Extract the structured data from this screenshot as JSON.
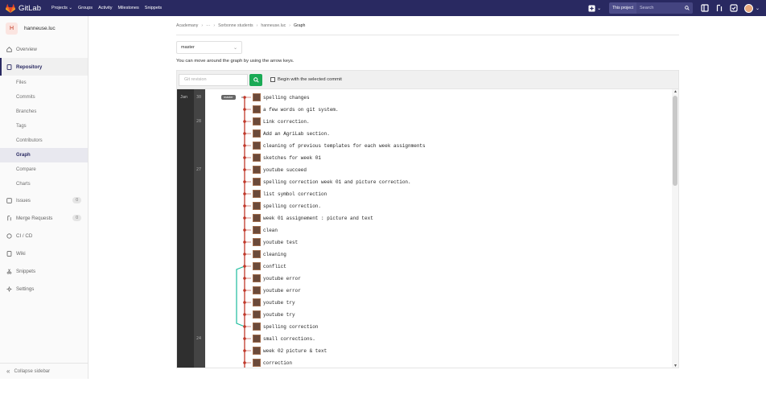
{
  "topbar": {
    "brand": "GitLab",
    "nav": [
      "Projects ⌄",
      "Groups",
      "Activity",
      "Milestones",
      "Snippets"
    ],
    "scope": "This project",
    "search_placeholder": "Search",
    "bg": "#292961"
  },
  "sidebar": {
    "project_initial": "H",
    "project_name": "hanneuse.luc",
    "overview": "Overview",
    "repository": "Repository",
    "repo_items": [
      "Files",
      "Commits",
      "Branches",
      "Tags",
      "Contributors",
      "Graph",
      "Compare",
      "Charts"
    ],
    "issues": "Issues",
    "issues_count": "0",
    "merge_requests": "Merge Requests",
    "merge_requests_count": "0",
    "cicd": "CI / CD",
    "wiki": "Wiki",
    "snippets": "Snippets",
    "settings": "Settings",
    "collapse": "Collapse sidebar"
  },
  "breadcrumb": {
    "items": [
      "Academany",
      "···",
      "Sorbonne students",
      "hanneuse.luc"
    ],
    "current": "Graph"
  },
  "branch": {
    "selected": "master"
  },
  "hint": "You can move around the graph by using the arrow keys.",
  "toolbar": {
    "rev_placeholder": "Git revision",
    "begin_label": "Begin with the selected commit"
  },
  "graph": {
    "month": "Jan",
    "days": [
      {
        "label": "30",
        "row": 0
      },
      {
        "label": "28",
        "row": 2
      },
      {
        "label": "27",
        "row": 6
      },
      {
        "label": "24",
        "row": 20
      }
    ],
    "branch_tag": "master",
    "commits": [
      "spelling changes",
      "a few words on git system.",
      "Link correction.",
      "Add an AgriLab section.",
      "cleaning of previous templates for each week assignments",
      "sketches for week 01",
      "youtube succeed",
      "spelling correction week 01 and picture correction.",
      "list symbol correction",
      "spelling correction.",
      "week 01 assignement : picture and text",
      "clean",
      "youtube test",
      "cleaning",
      "conflict",
      "youtube error",
      "youtube error",
      "youtube try",
      "youtube try",
      "spelling correction",
      "small corrections.",
      "week 02 picture & text",
      "correction"
    ],
    "colors": {
      "main": "#c0392b",
      "side": "#1abc9c"
    }
  }
}
